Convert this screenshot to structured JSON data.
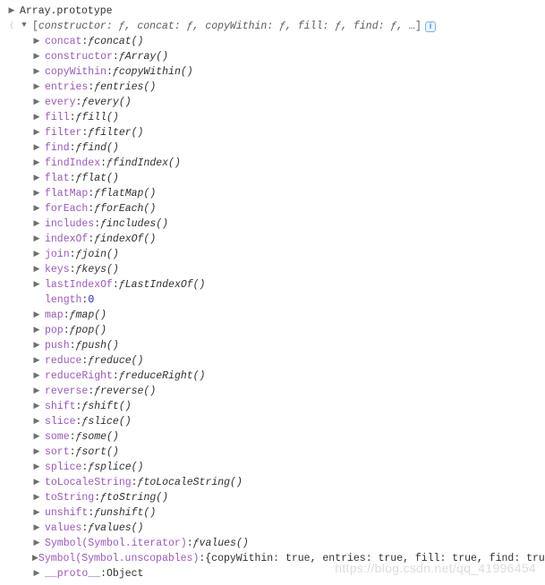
{
  "input": "Array.prototype",
  "summary": {
    "open": "[",
    "items": [
      "constructor: ƒ",
      "concat: ƒ",
      "copyWithin: ƒ",
      "fill: ƒ",
      "find: ƒ",
      "…"
    ],
    "close": "]"
  },
  "methods": [
    {
      "name": "concat",
      "sig": "concat()"
    },
    {
      "name": "constructor",
      "sig": "Array()"
    },
    {
      "name": "copyWithin",
      "sig": "copyWithin()"
    },
    {
      "name": "entries",
      "sig": "entries()"
    },
    {
      "name": "every",
      "sig": "every()"
    },
    {
      "name": "fill",
      "sig": "fill()"
    },
    {
      "name": "filter",
      "sig": "filter()"
    },
    {
      "name": "find",
      "sig": "find()"
    },
    {
      "name": "findIndex",
      "sig": "findIndex()"
    },
    {
      "name": "flat",
      "sig": "flat()"
    },
    {
      "name": "flatMap",
      "sig": "flatMap()"
    },
    {
      "name": "forEach",
      "sig": "forEach()"
    },
    {
      "name": "includes",
      "sig": "includes()"
    },
    {
      "name": "indexOf",
      "sig": "indexOf()"
    },
    {
      "name": "join",
      "sig": "join()"
    },
    {
      "name": "keys",
      "sig": "keys()"
    },
    {
      "name": "lastIndexOf",
      "sig": "LastIndexOf()"
    }
  ],
  "length": {
    "key": "length",
    "value": "0"
  },
  "methods2": [
    {
      "name": "map",
      "sig": "map()"
    },
    {
      "name": "pop",
      "sig": "pop()"
    },
    {
      "name": "push",
      "sig": "push()"
    },
    {
      "name": "reduce",
      "sig": "reduce()"
    },
    {
      "name": "reduceRight",
      "sig": "reduceRight()"
    },
    {
      "name": "reverse",
      "sig": "reverse()"
    },
    {
      "name": "shift",
      "sig": "shift()"
    },
    {
      "name": "slice",
      "sig": "slice()"
    },
    {
      "name": "some",
      "sig": "some()"
    },
    {
      "name": "sort",
      "sig": "sort()"
    },
    {
      "name": "splice",
      "sig": "splice()"
    },
    {
      "name": "toLocaleString",
      "sig": "toLocaleString()"
    },
    {
      "name": "toString",
      "sig": "toString()"
    },
    {
      "name": "unshift",
      "sig": "unshift()"
    },
    {
      "name": "values",
      "sig": "values()"
    }
  ],
  "symbols": [
    {
      "key": "Symbol(Symbol.iterator)",
      "type": "func",
      "sig": "values()"
    },
    {
      "key": "Symbol(Symbol.unscopables)",
      "type": "obj",
      "preview": "{copyWithin: true, entries: true, fill: true, find: tru…"
    }
  ],
  "proto": {
    "key": "__proto__",
    "value": "Object"
  },
  "watermark": "https://blog.csdn.net/qq_41996454"
}
